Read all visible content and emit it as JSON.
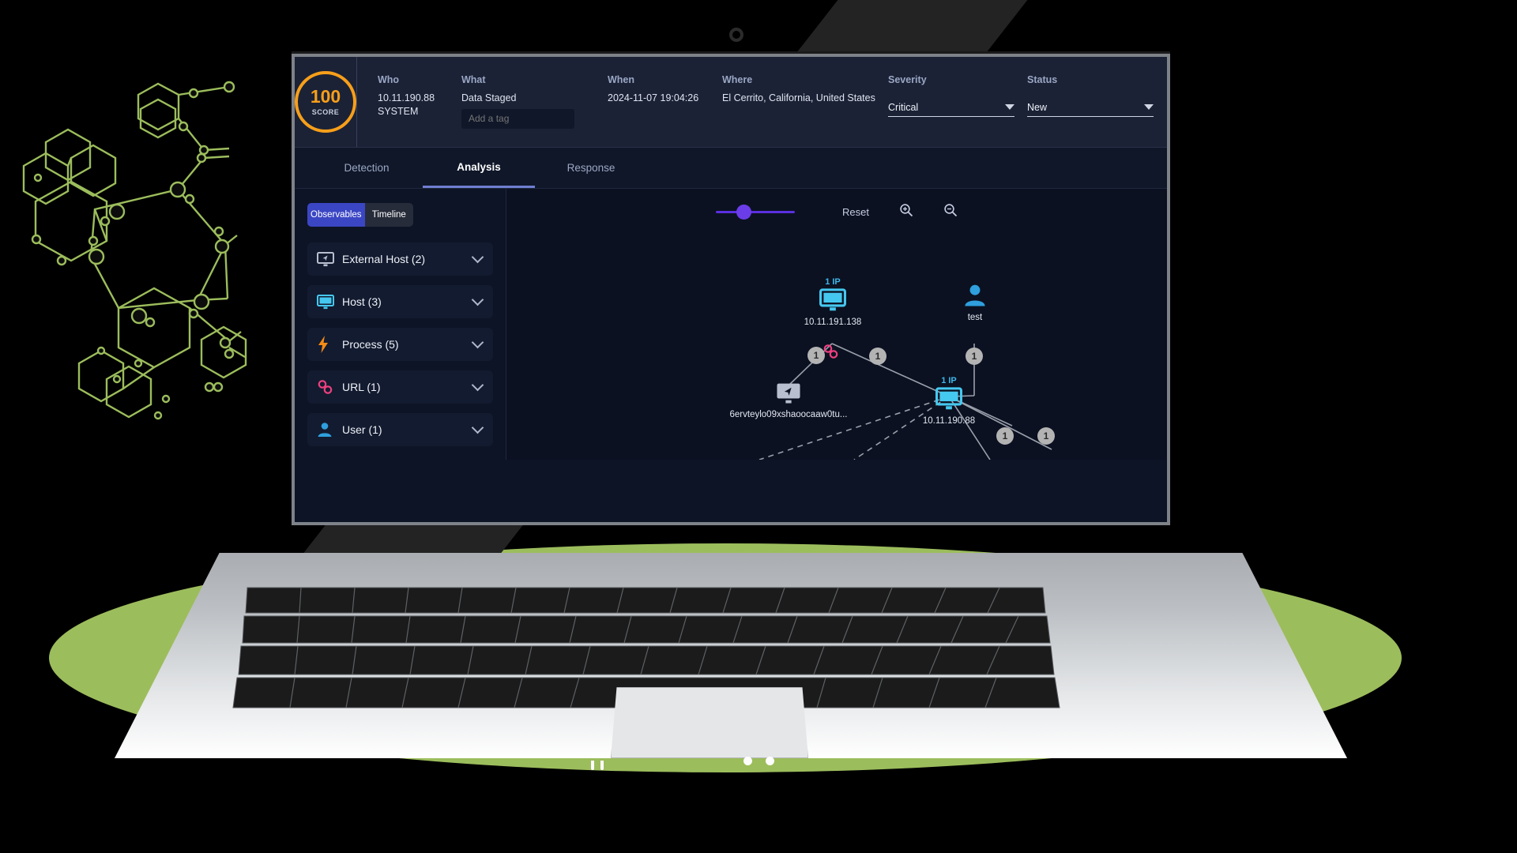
{
  "header": {
    "score": {
      "value": "100",
      "label": "SCORE",
      "color": "#f79f1a"
    },
    "fields": [
      {
        "label": "Who",
        "value": "10.11.190.88",
        "value2": "SYSTEM"
      },
      {
        "label": "What",
        "value": "Data Staged"
      },
      {
        "label": "When",
        "value": "2024-11-07 19:04:26"
      },
      {
        "label": "Where",
        "value": "El Cerrito, California, United States"
      }
    ],
    "tag_placeholder": "Add a tag",
    "severity": {
      "label": "Severity",
      "value": "Critical"
    },
    "status": {
      "label": "Status",
      "value": "New"
    }
  },
  "tabs": [
    {
      "label": "Detection",
      "active": false
    },
    {
      "label": "Analysis",
      "active": true
    },
    {
      "label": "Response",
      "active": false
    }
  ],
  "sidebar": {
    "segmented": [
      {
        "label": "Observables",
        "selected": true
      },
      {
        "label": "Timeline",
        "selected": false
      }
    ],
    "items": [
      {
        "label": "External Host (2)",
        "icon": "external-host-icon",
        "color": "#b8bfce"
      },
      {
        "label": "Host (3)",
        "icon": "host-monitor-icon",
        "color": "#45c8f0"
      },
      {
        "label": "Process (5)",
        "icon": "process-bolt-icon",
        "color": "#f58a15"
      },
      {
        "label": "URL (1)",
        "icon": "url-link-icon",
        "color": "#f0407f"
      },
      {
        "label": "User (1)",
        "icon": "user-person-icon",
        "color": "#2f9fdd"
      }
    ]
  },
  "graph_toolbar": {
    "reset_label": "Reset",
    "zoom_in_icon": "zoom-in-icon",
    "zoom_out_icon": "zoom-out-icon",
    "slider_value": 30,
    "accent": "#6b3de8"
  },
  "graph": {
    "nodes": [
      {
        "id": "n1",
        "top_label": "1 IP",
        "label": "10.11.191.138",
        "icon": "host-monitor-icon",
        "color": "#45c8f0"
      },
      {
        "id": "n2",
        "top_label": "",
        "label": "test",
        "icon": "user-person-icon",
        "color": "#2f9fdd"
      },
      {
        "id": "n3",
        "top_label": "",
        "label": "6ervteylo09xshaoocaaw0tu...",
        "icon": "external-host-icon",
        "color": "#b8bfce"
      },
      {
        "id": "n4",
        "top_label": "1 IP",
        "label": "10.11.190.88",
        "icon": "host-monitor-icon",
        "color": "#45c8f0"
      }
    ],
    "edge_badges": [
      "1",
      "1",
      "1",
      "1",
      "1"
    ],
    "url_marker_icon": "url-link-icon"
  },
  "carousel": {
    "dots": 2,
    "active_index": 0
  }
}
